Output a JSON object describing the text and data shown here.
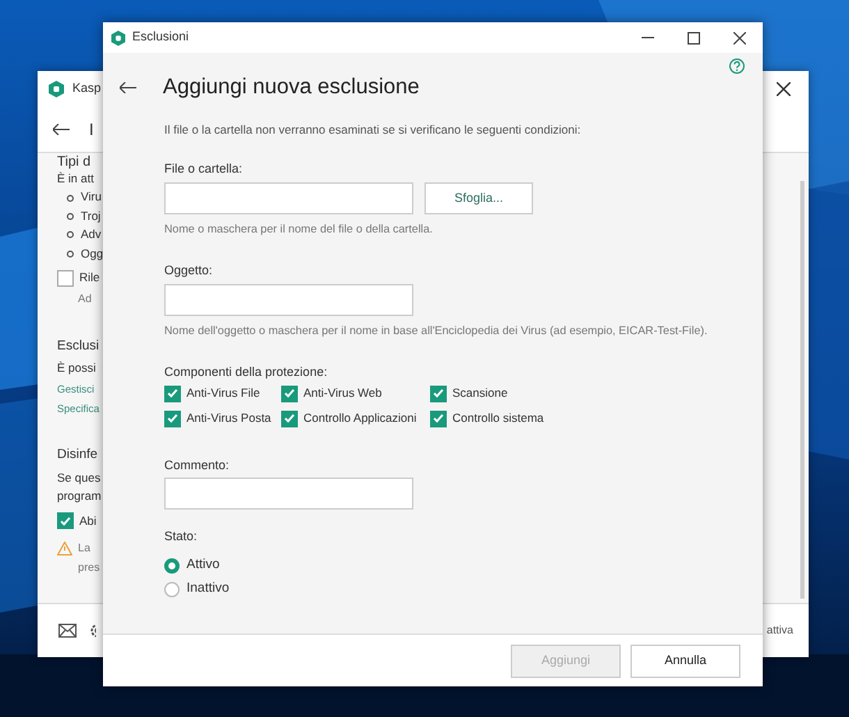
{
  "back_window": {
    "title": "Kasp",
    "heading": "I",
    "content": [
      {
        "kind": "heading",
        "text": "Tipi d"
      },
      {
        "kind": "text",
        "text": "È in att"
      },
      {
        "kind": "bullet",
        "text": "Viru"
      },
      {
        "kind": "bullet",
        "text": "Troj"
      },
      {
        "kind": "bullet",
        "text": "Adv"
      },
      {
        "kind": "bullet",
        "text": "Ogg"
      },
      {
        "kind": "checkbox",
        "text": "Rile",
        "checked": false
      },
      {
        "kind": "note",
        "text": "Ad"
      },
      {
        "kind": "section",
        "text": "Esclusi"
      },
      {
        "kind": "text",
        "text": "È possi"
      },
      {
        "kind": "link",
        "text": "Gestisci"
      },
      {
        "kind": "link",
        "text": "Specifica"
      },
      {
        "kind": "section",
        "text": "Disinfe"
      },
      {
        "kind": "text",
        "text": "Se ques"
      },
      {
        "kind": "text",
        "text": "program"
      },
      {
        "kind": "checkbox",
        "text": "Abi",
        "checked": true
      },
      {
        "kind": "warning",
        "text": "La"
      },
      {
        "kind": "note",
        "text": "pres"
      }
    ],
    "footer_text": "attiva"
  },
  "dialog": {
    "title": "Esclusioni",
    "heading": "Aggiungi nuova esclusione",
    "description": "Il file o la cartella non verranno esaminati se si verificano le seguenti condizioni:",
    "file_field": {
      "label": "File o cartella:",
      "button": "Sfoglia...",
      "hint": "Nome o maschera per il nome del file o della cartella."
    },
    "object_field": {
      "label": "Oggetto:",
      "hint": "Nome dell'oggetto o maschera per il nome in base all'Enciclopedia dei Virus (ad esempio, EICAR-Test-File)."
    },
    "components": {
      "label": "Componenti della protezione:",
      "items": [
        {
          "label": "Anti-Virus File",
          "checked": true
        },
        {
          "label": "Anti-Virus Web",
          "checked": true
        },
        {
          "label": "Scansione",
          "checked": true
        },
        {
          "label": "Anti-Virus Posta",
          "checked": true
        },
        {
          "label": "Controllo Applicazioni",
          "checked": true
        },
        {
          "label": "Controllo sistema",
          "checked": true
        }
      ]
    },
    "comment_field": {
      "label": "Commento:"
    },
    "state": {
      "label": "Stato:",
      "options": [
        {
          "label": "Attivo",
          "selected": true
        },
        {
          "label": "Inattivo",
          "selected": false
        }
      ]
    },
    "buttons": [
      {
        "label": "Aggiungi",
        "disabled": true
      },
      {
        "label": "Annulla",
        "disabled": false
      }
    ]
  }
}
